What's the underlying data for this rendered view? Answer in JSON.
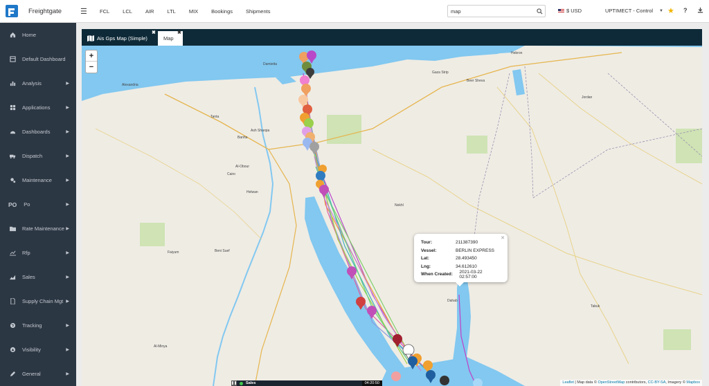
{
  "brand": {
    "name": "Freightgate"
  },
  "topnav": [
    "FCL",
    "LCL",
    "AIR",
    "LTL",
    "MIX",
    "Bookings",
    "Shipments"
  ],
  "search": {
    "value": "map"
  },
  "currency": {
    "label": "$ USD"
  },
  "account": {
    "label": "UPTIMECT - Control"
  },
  "sidebar": {
    "items": [
      {
        "label": "Home",
        "icon": "home-icon",
        "arrow": false
      },
      {
        "label": "Default Dashboard",
        "icon": "dashboard-icon",
        "arrow": false
      },
      {
        "label": "Analysis",
        "icon": "bar-chart-icon",
        "arrow": true
      },
      {
        "label": "Applications",
        "icon": "grid-icon",
        "arrow": true
      },
      {
        "label": "Dashboards",
        "icon": "gauge-icon",
        "arrow": true
      },
      {
        "label": "Dispatch",
        "icon": "truck-icon",
        "arrow": true
      },
      {
        "label": "Maintenance",
        "icon": "gears-icon",
        "arrow": true
      },
      {
        "label": "Po",
        "icon": "po-icon",
        "arrow": true,
        "prefix": "PO"
      },
      {
        "label": "Rate Maintenance",
        "icon": "folder-icon",
        "arrow": true
      },
      {
        "label": "Rfp",
        "icon": "line-chart-icon",
        "arrow": true
      },
      {
        "label": "Sales",
        "icon": "area-chart-icon",
        "arrow": true
      },
      {
        "label": "Supply Chain Mgt",
        "icon": "file-icon",
        "arrow": true
      },
      {
        "label": "Tracking",
        "icon": "globe-icon",
        "arrow": true
      },
      {
        "label": "Visibility",
        "icon": "compass-icon",
        "arrow": true
      },
      {
        "label": "General",
        "icon": "edit-icon",
        "arrow": true
      }
    ]
  },
  "tabs": [
    {
      "label": "Ais Gps Map (Simple)"
    },
    {
      "label": "Map"
    }
  ],
  "popup": {
    "rows": [
      {
        "key": "Tour:",
        "value": "211387390"
      },
      {
        "key": "Vessel:",
        "value": "BERLIN EXPRESS"
      },
      {
        "key": "Lat:",
        "value": "28.493450"
      },
      {
        "key": "Lng:",
        "value": "34.612610"
      },
      {
        "key": "When Created:",
        "value": "2021-03-22 02:57:00"
      }
    ]
  },
  "map_labels": {
    "places": [
      "Damietta",
      "Alexandria",
      "Gaza Strip",
      "Hebron",
      "Beer Sheva",
      "Jordan",
      "Tanta",
      "Banha",
      "Al-Obour",
      "Cairo",
      "Helwan",
      "Faiyum",
      "Beni Suef",
      "Nekhl",
      "Dahab",
      "Tabuk",
      "Al-Minya",
      "Ash Sharqia"
    ]
  },
  "attribution": {
    "leaflet": "Leaflet",
    "text1": " | Map data © ",
    "osm": "OpenStreetMap",
    "text2": " contributors, ",
    "license": "CC-BY-SA",
    "text3": ", Imagery © ",
    "mapbox": "Mapbox"
  },
  "bottombar": {
    "label": "Sales",
    "time": "04:20:50"
  },
  "colors": {
    "sidebar_bg": "#2c3744",
    "tabbar_bg": "#0e2a38",
    "water": "#82c8f0",
    "land": "#efece4",
    "star": "#f0b400"
  }
}
